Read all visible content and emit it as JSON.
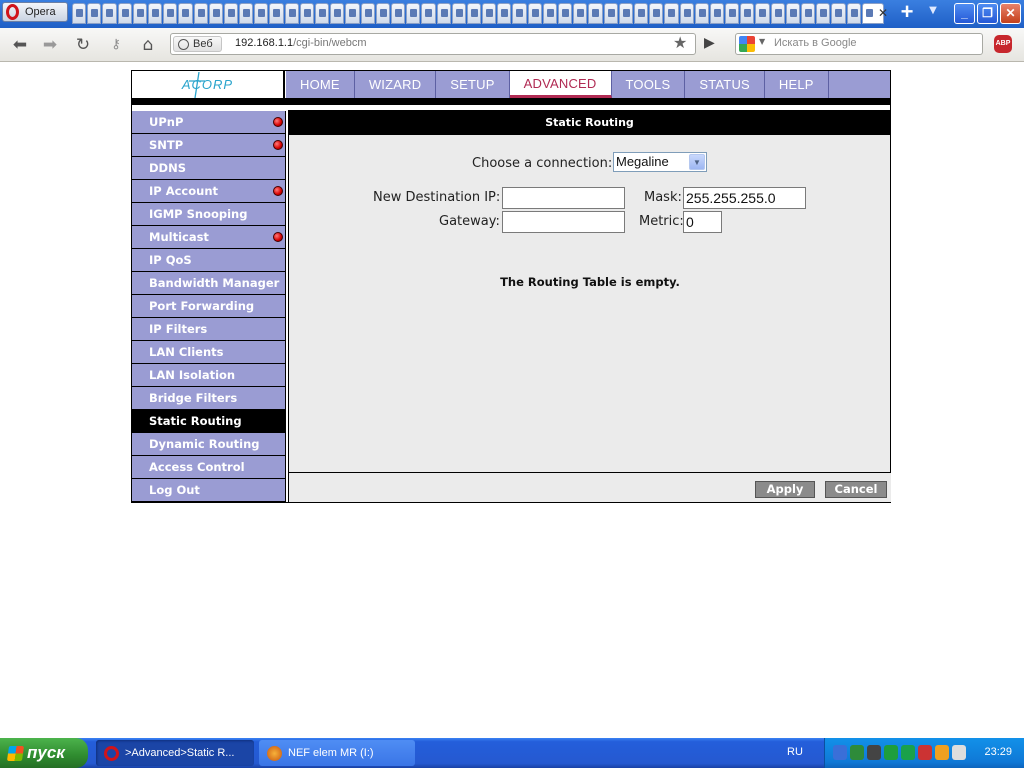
{
  "browser": {
    "menu_label": "Opera",
    "tab_count": 53,
    "address": {
      "badge": "Веб",
      "url_host": "192.168.1.1",
      "url_path": "/cgi-bin/webcm"
    },
    "search_placeholder": "Искать в Google",
    "abp_label": "ABP",
    "icons": [
      "back-arrow-icon",
      "forward-arrow-icon",
      "reload-icon",
      "wand-key-icon",
      "home-icon",
      "star-icon",
      "go-icon"
    ]
  },
  "router": {
    "logo": "ACORP",
    "topnav": [
      {
        "label": "HOME",
        "active": false
      },
      {
        "label": "WIZARD",
        "active": false
      },
      {
        "label": "SETUP",
        "active": false
      },
      {
        "label": "ADVANCED",
        "active": true
      },
      {
        "label": "TOOLS",
        "active": false
      },
      {
        "label": "STATUS",
        "active": false
      },
      {
        "label": "HELP",
        "active": false
      }
    ],
    "sidebar": [
      {
        "label": "UPnP",
        "dot": true
      },
      {
        "label": "SNTP",
        "dot": true
      },
      {
        "label": "DDNS",
        "dot": false
      },
      {
        "label": "IP Account",
        "dot": true
      },
      {
        "label": "IGMP Snooping",
        "dot": false
      },
      {
        "label": "Multicast",
        "dot": true
      },
      {
        "label": "IP QoS",
        "dot": false
      },
      {
        "label": "Bandwidth Manager",
        "dot": false
      },
      {
        "label": "Port Forwarding",
        "dot": false
      },
      {
        "label": "IP Filters",
        "dot": false
      },
      {
        "label": "LAN Clients",
        "dot": false
      },
      {
        "label": "LAN Isolation",
        "dot": false
      },
      {
        "label": "Bridge Filters",
        "dot": false
      },
      {
        "label": "Static Routing",
        "dot": false,
        "active": true
      },
      {
        "label": "Dynamic Routing",
        "dot": false
      },
      {
        "label": "Access Control",
        "dot": false
      },
      {
        "label": "Log Out",
        "dot": false
      }
    ],
    "page": {
      "title": "Static Routing",
      "connection_label": "Choose a connection:",
      "connection_value": "Megaline",
      "dest_ip_label": "New Destination IP:",
      "dest_ip_value": "",
      "mask_label": "Mask:",
      "mask_value": "255.255.255.0",
      "gateway_label": "Gateway:",
      "gateway_value": "",
      "metric_label": "Metric:",
      "metric_value": "0",
      "empty_message": "The Routing Table is empty.",
      "apply_label": "Apply",
      "cancel_label": "Cancel"
    },
    "colors": {
      "nav_bg": "#9a9cd3",
      "active_tab_text": "#b02a53",
      "content_bg": "#ebebeb",
      "button_bg": "#8b8b8b",
      "status_dot": "#d80000"
    }
  },
  "taskbar": {
    "start_label": "пуск",
    "items": [
      {
        "label": ">Advanced>Static R...",
        "icon": "opera-icon",
        "active": true
      },
      {
        "label": "NEF elem MR (I:)",
        "icon": "drive-icon",
        "active": false
      }
    ],
    "language": "RU",
    "clock": "23:29",
    "tray_icon_colors": [
      "#3a6fd8",
      "#2e8b3a",
      "#444444",
      "#1e9e3c",
      "#1aa14b",
      "#cc3333",
      "#f0a020",
      "#dddddd"
    ]
  }
}
